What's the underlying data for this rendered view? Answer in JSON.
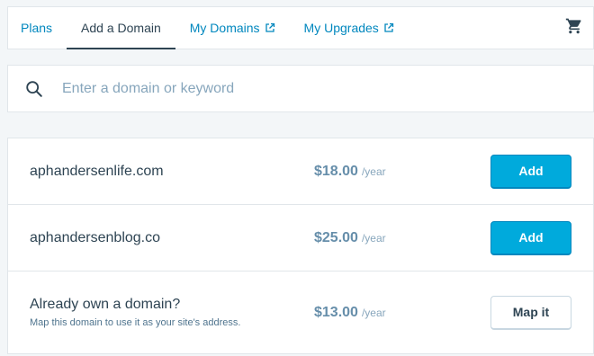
{
  "nav": {
    "tabs": [
      {
        "label": "Plans",
        "external": false
      },
      {
        "label": "Add a Domain",
        "external": false,
        "active": true
      },
      {
        "label": "My Domains",
        "external": true
      },
      {
        "label": "My Upgrades",
        "external": true
      }
    ],
    "cart_icon": "cart-icon"
  },
  "search": {
    "placeholder": "Enter a domain or keyword",
    "value": ""
  },
  "results": [
    {
      "domain": "aphandersenlife.com",
      "price": "$18.00",
      "per": "/year",
      "action": "Add"
    },
    {
      "domain": "aphandersenblog.co",
      "price": "$25.00",
      "per": "/year",
      "action": "Add"
    },
    {
      "title": "Already own a domain?",
      "subtitle": "Map this domain to use it as your site's address.",
      "price": "$13.00",
      "per": "/year",
      "action": "Map it"
    }
  ],
  "colors": {
    "accent": "#00aadc",
    "link": "#0087be",
    "price": "#668eaa",
    "text": "#2e4453"
  }
}
